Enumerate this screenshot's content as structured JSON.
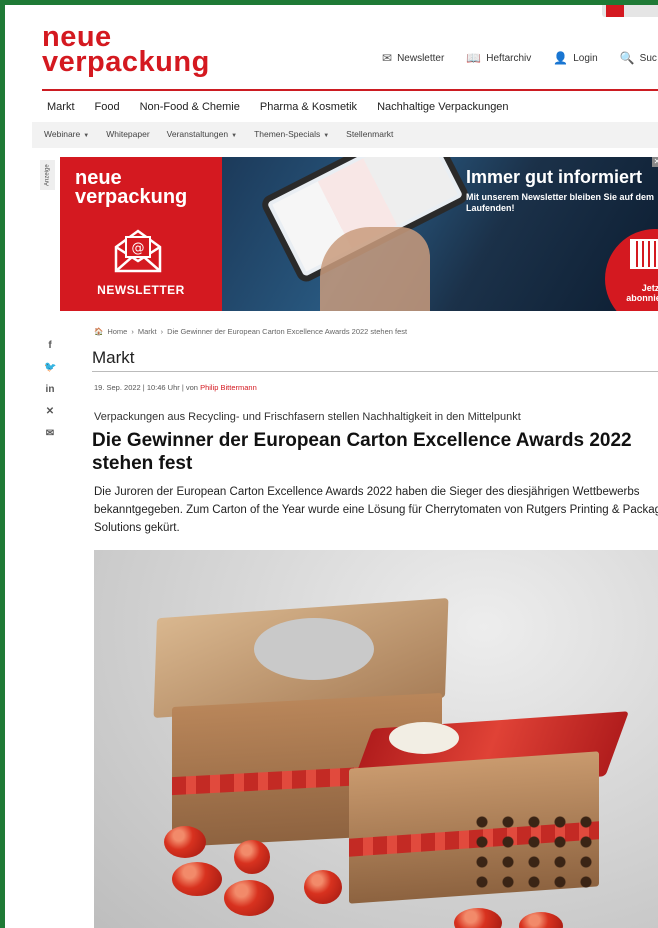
{
  "site": {
    "logo_line1": "neue",
    "logo_line2": "verpackung"
  },
  "topnav": [
    {
      "icon": "mail-icon",
      "label": "Newsletter"
    },
    {
      "icon": "book-icon",
      "label": "Heftarchiv"
    },
    {
      "icon": "user-icon",
      "label": "Login"
    },
    {
      "icon": "search-icon",
      "label": "Suc"
    }
  ],
  "mainnav": [
    "Markt",
    "Food",
    "Non-Food & Chemie",
    "Pharma & Kosmetik",
    "Nachhaltige Verpackungen"
  ],
  "subnav": [
    {
      "label": "Webinare",
      "dropdown": true
    },
    {
      "label": "Whitepaper",
      "dropdown": false
    },
    {
      "label": "Veranstaltungen",
      "dropdown": true
    },
    {
      "label": "Themen-Specials",
      "dropdown": true
    },
    {
      "label": "Stellenmarkt",
      "dropdown": false
    }
  ],
  "banner": {
    "anzeige": "Anzeige",
    "logo_line1": "neue",
    "logo_line2": "verpackung",
    "newsletter_label": "NEWSLETTER",
    "headline": "Immer gut informiert",
    "subtext": "Mit unserem Newsletter bleiben Sie auf dem Laufenden!",
    "cta_line1": "Jetzt",
    "cta_line2": "abonnieren!",
    "close": "✕"
  },
  "social": [
    {
      "icon": "facebook-icon",
      "glyph": "f"
    },
    {
      "icon": "twitter-icon",
      "glyph": "🐦"
    },
    {
      "icon": "linkedin-icon",
      "glyph": "in"
    },
    {
      "icon": "xing-icon",
      "glyph": "✕"
    },
    {
      "icon": "mail-icon",
      "glyph": "✉"
    }
  ],
  "breadcrumb": {
    "home": "Home",
    "section": "Markt",
    "current": "Die Gewinner der European Carton Excellence Awards 2022 stehen fest"
  },
  "article": {
    "section": "Markt",
    "date": "19. Sep. 2022 | 10:46 Uhr | von",
    "author": "Philip Bittermann",
    "kicker": "Verpackungen aus Recycling- und Frischfasern stellen Nachhaltigkeit in den Mittelpunkt",
    "title": "Die Gewinner der European Carton Excellence Awards 2022 stehen fest",
    "lead": "Die Juroren der European Carton Excellence Awards 2022 haben die Sieger des diesjährigen Wettbewerbs bekanntgegeben. Zum Carton of the Year wurde eine Lösung für Cherrytomaten von Rutgers Printing & Packaging Solutions gekürt."
  },
  "colors": {
    "brand_red": "#d41920",
    "frame_green": "#1f7a36"
  }
}
